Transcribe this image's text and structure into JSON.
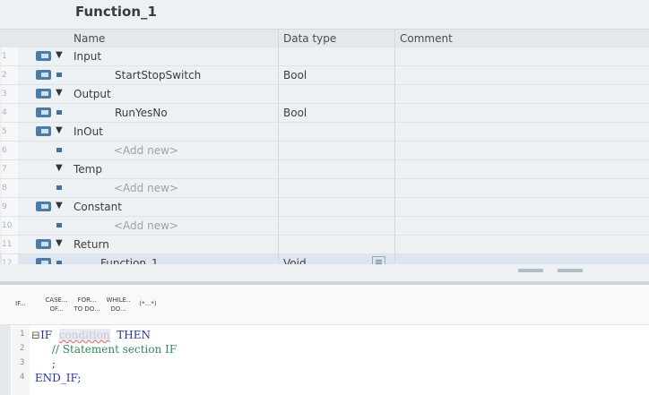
{
  "block_title": "Function_1",
  "columns": {
    "name": "Name",
    "data_type": "Data type",
    "comment": "Comment"
  },
  "rows": [
    {
      "num": "1",
      "kind": "group",
      "name": "Input"
    },
    {
      "num": "2",
      "kind": "var",
      "name": "StartStopSwitch",
      "data_type": "Bool"
    },
    {
      "num": "3",
      "kind": "group",
      "name": "Output"
    },
    {
      "num": "4",
      "kind": "var",
      "name": "RunYesNo",
      "data_type": "Bool"
    },
    {
      "num": "5",
      "kind": "group",
      "name": "InOut"
    },
    {
      "num": "6",
      "kind": "add",
      "name": "<Add new>"
    },
    {
      "num": "7",
      "kind": "group",
      "name": "Temp"
    },
    {
      "num": "8",
      "kind": "add",
      "name": "<Add new>"
    },
    {
      "num": "9",
      "kind": "group",
      "name": "Constant"
    },
    {
      "num": "10",
      "kind": "add",
      "name": "<Add new>"
    },
    {
      "num": "11",
      "kind": "group",
      "name": "Return"
    },
    {
      "num": "12",
      "kind": "ret",
      "name": "Function_1",
      "data_type": "Void"
    }
  ],
  "toolbar": {
    "if": "IF...",
    "case_1": "CASE...",
    "case_2": "OF...",
    "for_1": "FOR...",
    "for_2": "TO DO...",
    "while_1": "WHILE..",
    "while_2": "DO...",
    "comment": "(*...*)"
  },
  "code": [
    {
      "num": "1",
      "kw1": "IF",
      "cond": "condition",
      "kw2": "THEN"
    },
    {
      "num": "2",
      "comment": "// Statement section IF"
    },
    {
      "num": "3",
      "text": ";"
    },
    {
      "num": "4",
      "kw1": "END_IF;"
    }
  ]
}
